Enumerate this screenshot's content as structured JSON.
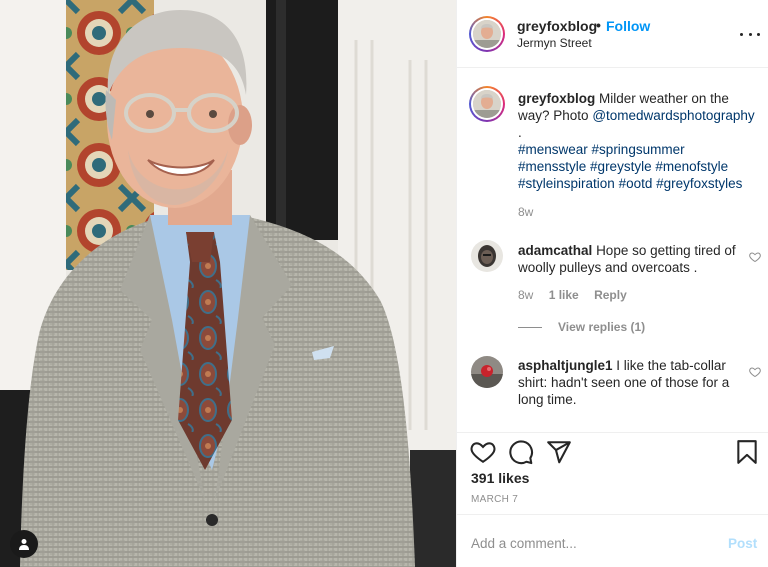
{
  "post": {
    "username": "greyfoxblog",
    "separator": "•",
    "follow_label": "Follow",
    "location": "Jermyn Street",
    "more_icon": "more-horizontal-icon"
  },
  "caption": {
    "username": "greyfoxblog",
    "text": "Milder weather on the way? Photo",
    "mention": "@tomedwardsphotography",
    "trailing": ".",
    "hashtags": [
      "#menswear",
      "#springsummer",
      "#mensstyle",
      "#greystyle",
      "#menofstyle",
      "#styleinspiration",
      "#ootd",
      "#greyfoxstyles"
    ],
    "time": "8w"
  },
  "comments": [
    {
      "username": "adamcathal",
      "text": "Hope so getting tired of woolly pulleys and overcoats .",
      "time": "8w",
      "likes": "1 like",
      "reply_label": "Reply",
      "view_replies": "View replies (1)"
    },
    {
      "username": "asphaltjungle1",
      "text": "I like the tab-collar shirt: hadn't seen one of those for a long time."
    }
  ],
  "actions": {
    "icons": [
      "heart-icon",
      "comment-icon",
      "share-icon",
      "bookmark-icon"
    ],
    "likes": "391 likes",
    "date": "MARCH 7"
  },
  "add_comment": {
    "placeholder": "Add a comment...",
    "post_label": "Post"
  },
  "colors": {
    "follow": "#0095f6",
    "hashtag": "#00376b",
    "muted": "#8e8e8e",
    "post_disabled": "#b2dffc"
  }
}
